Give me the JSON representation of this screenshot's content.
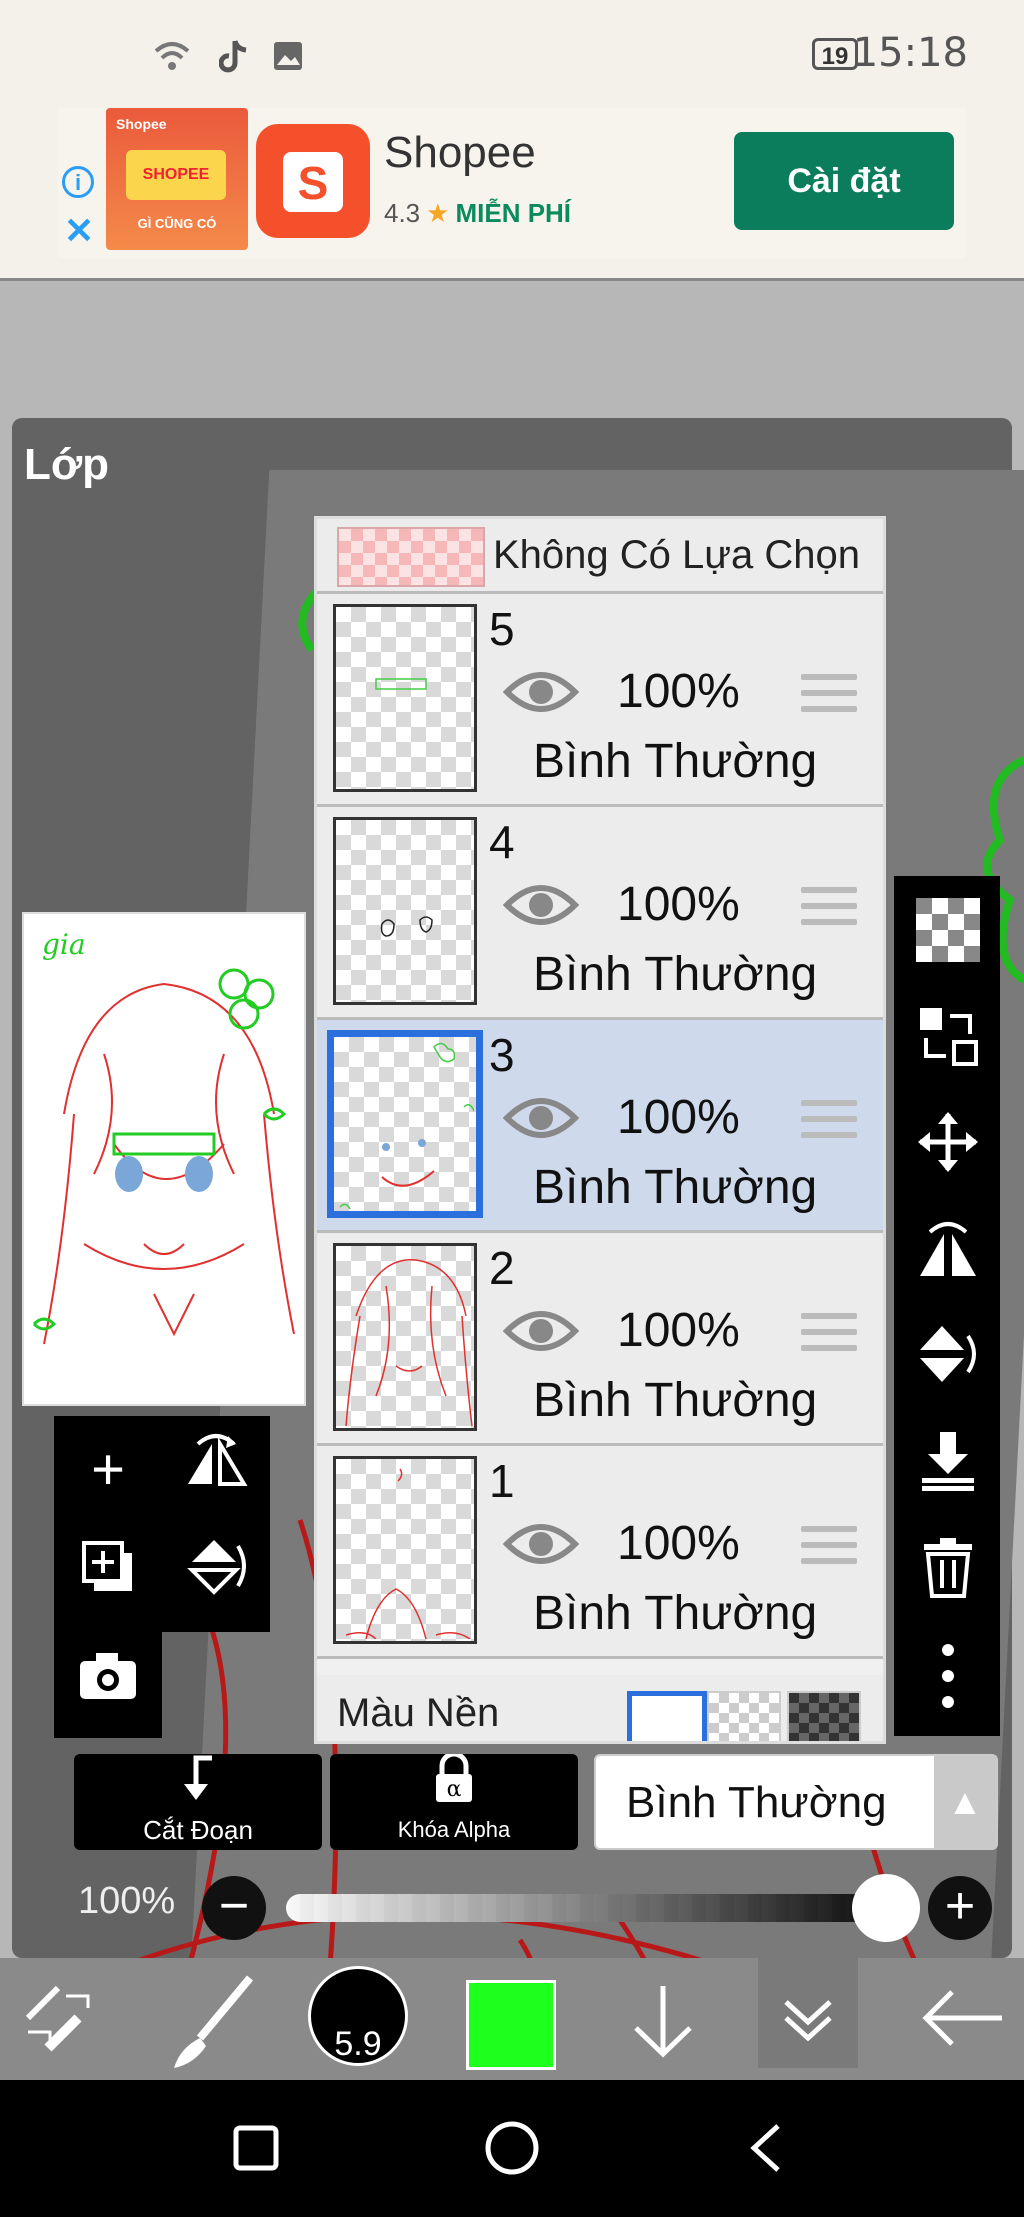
{
  "status_bar": {
    "time": "15:18",
    "battery": "19",
    "icons": [
      "wifi-icon",
      "tiktok-icon",
      "image-icon"
    ]
  },
  "ad": {
    "app_name": "Shopee",
    "rating": "4.3",
    "price_label": "MIỄN PHÍ",
    "install_label": "Cài đặt",
    "thumb_top": "Shopee",
    "thumb_mid": "SHOPEE",
    "thumb_bottom": "GÌ CŨNG CÓ",
    "logo_letter": "S"
  },
  "panel": {
    "title": "Lớp"
  },
  "preview_text": "gia",
  "layers": {
    "selection_label": "Không Có Lựa Chọn",
    "items": [
      {
        "number": "5",
        "opacity": "100%",
        "mode": "Bình Thường",
        "active": false
      },
      {
        "number": "4",
        "opacity": "100%",
        "mode": "Bình Thường",
        "active": false
      },
      {
        "number": "3",
        "opacity": "100%",
        "mode": "Bình Thường",
        "active": true
      },
      {
        "number": "2",
        "opacity": "100%",
        "mode": "Bình Thường",
        "active": false
      },
      {
        "number": "1",
        "opacity": "100%",
        "mode": "Bình Thường",
        "active": false
      }
    ],
    "background_label": "Màu Nền"
  },
  "controls": {
    "clip_label": "Cắt Đoạn",
    "alpha_lock_label": "Khóa Alpha",
    "alpha_icon_text": "α",
    "blend_mode": "Bình Thường",
    "opacity": "100%"
  },
  "toolbar": {
    "brush_size": "5.9",
    "color": "#1dff1d"
  },
  "colors": {
    "active_layer": "#cfd9ec",
    "selection_border": "#2a6fdb",
    "install_button": "#0b7d5c",
    "shopee_orange": "#f4502c"
  }
}
